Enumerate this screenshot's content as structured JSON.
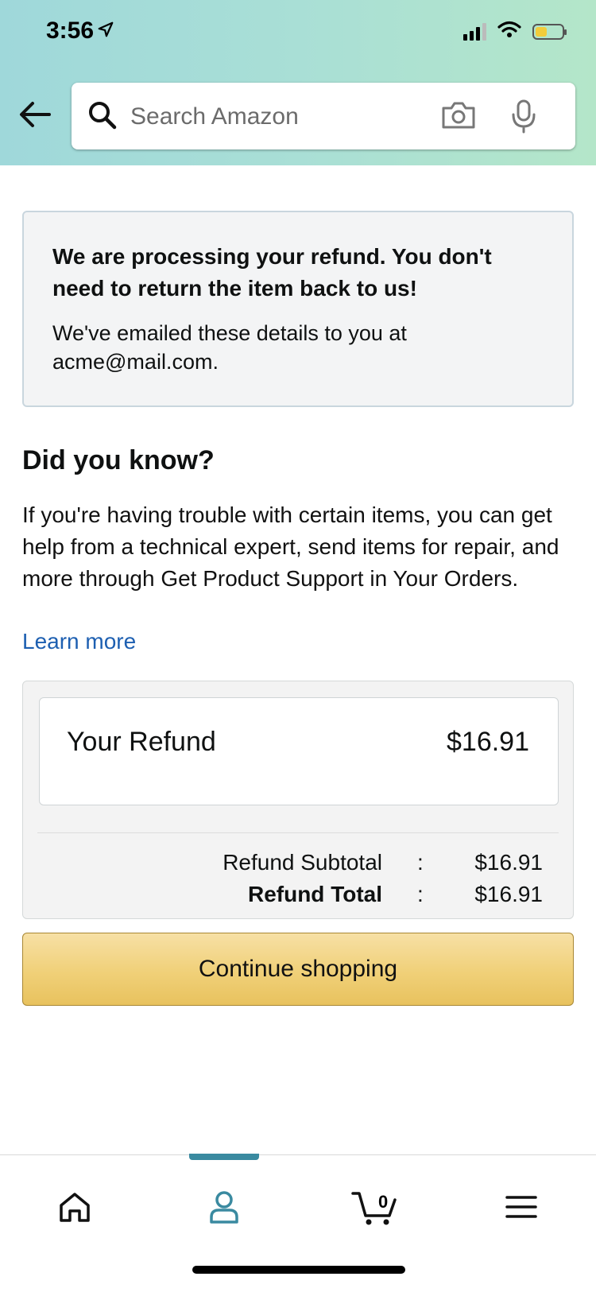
{
  "status_bar": {
    "time": "3:56",
    "location_icon": "location-arrow-icon",
    "signal_icon": "signal-icon",
    "wifi_icon": "wifi-icon",
    "battery_icon": "battery-icon"
  },
  "header": {
    "back_icon": "arrow-left-icon",
    "search": {
      "placeholder": "Search Amazon",
      "value": "",
      "search_icon": "search-icon",
      "camera_icon": "camera-icon",
      "mic_icon": "microphone-icon"
    }
  },
  "notice": {
    "title": "We are processing your refund. You don't need to return the item back to us!",
    "text": "We've emailed these details to you at acme@mail.com."
  },
  "did_you_know": {
    "title": "Did you know?",
    "text": "If you're having trouble with certain items, you can get help from a technical expert, send items for repair, and more through Get Product Support in Your Orders.",
    "link": "Learn more"
  },
  "refund": {
    "label": "Your Refund",
    "amount": "$16.91",
    "rows": [
      {
        "label": "Refund Subtotal",
        "separator": ":",
        "value": "$16.91"
      },
      {
        "label": "Refund Total",
        "separator": ":",
        "value": "$16.91"
      }
    ]
  },
  "continue_button": "Continue shopping",
  "bottom_nav": {
    "items": [
      {
        "name": "Home",
        "icon": "home-icon"
      },
      {
        "name": "Account",
        "icon": "person-icon",
        "active": true
      },
      {
        "name": "Cart",
        "icon": "cart-icon",
        "count": "0"
      },
      {
        "name": "Menu",
        "icon": "menu-icon"
      }
    ]
  },
  "colors": {
    "header_gradient_start": "#9fd8da",
    "header_gradient_end": "#b4e6c9",
    "link": "#1d5fb1",
    "button": "#f0d078",
    "active_tab": "#3a8aa0"
  }
}
